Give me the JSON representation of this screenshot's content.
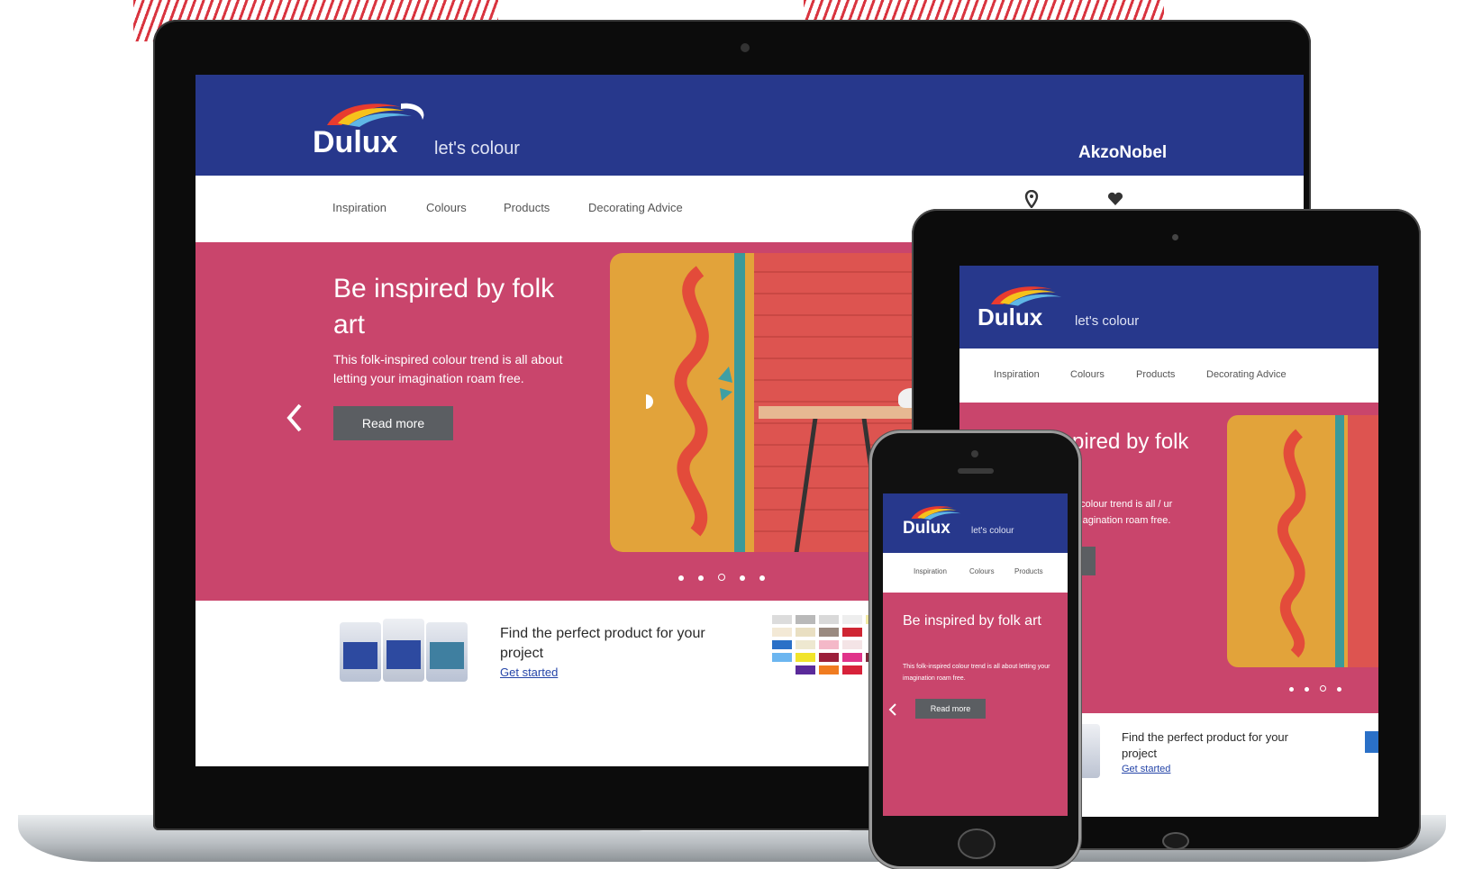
{
  "brand": {
    "name": "Dulux",
    "tagline": "let's colour",
    "parent": "AkzoNobel"
  },
  "nav": {
    "items": [
      "Inspiration",
      "Colours",
      "Products",
      "Decorating Advice"
    ]
  },
  "hero": {
    "title": "Be inspired by folk art",
    "body": "This folk-inspired colour trend is all about letting your imagination roam free.",
    "button": "Read more",
    "slides": 5,
    "active_slide": 3,
    "prev_icon": "chevron-left-icon"
  },
  "promo": {
    "title": "Find the perfect product for your project",
    "link": "Get started"
  },
  "tablet": {
    "hero_title_partial": "pired by folk",
    "hero_body_partial": "d colour trend is all / ur imagination roam free.",
    "promo_title": "Find the perfect product for your project",
    "promo_link": "Get started"
  },
  "phone": {
    "nav_items": [
      "Inspiration",
      "Colours",
      "Products"
    ],
    "hero_title": "Be inspired by folk art",
    "hero_body": "This folk-inspired colour trend is all about letting your imagination roam free.",
    "button": "Read more"
  },
  "colors": {
    "header_blue": "#27388c",
    "hero_pink": "#c9456c",
    "button_grey": "#5b5e62",
    "accent_red": "#d9343f"
  },
  "icons": [
    "location-pin-icon",
    "heart-icon",
    "chevron-left-icon",
    "dulux-swirl-logo"
  ]
}
